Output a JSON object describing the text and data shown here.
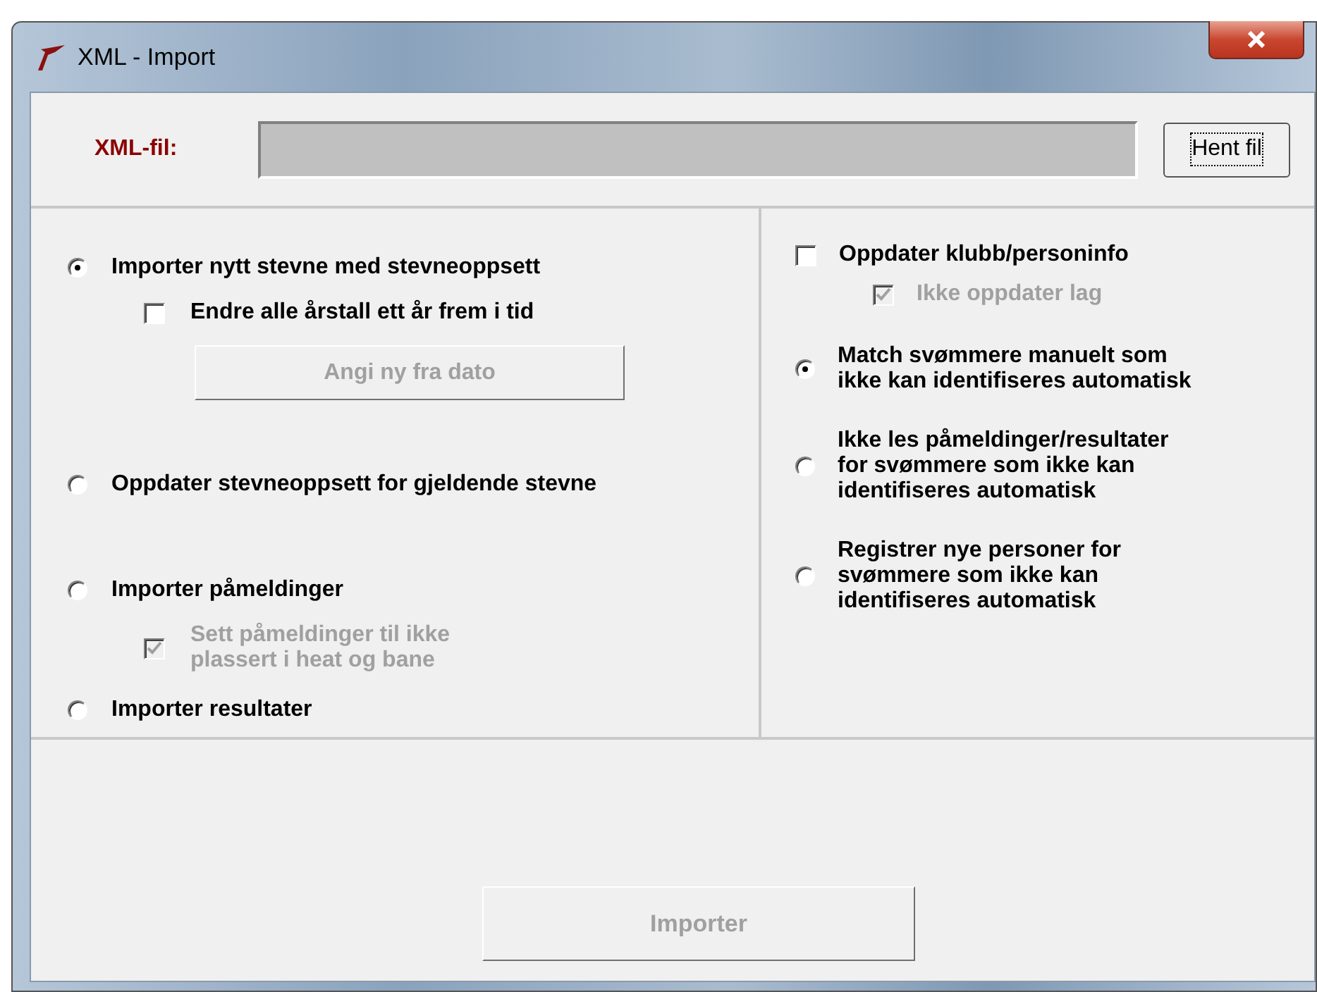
{
  "window": {
    "title": "XML - Import"
  },
  "file_row": {
    "label": "XML-fil:",
    "button": {
      "label": "Hent fil",
      "focused": true
    }
  },
  "left_options": [
    {
      "kind": "radio",
      "label": "Importer nytt stevne med stevneoppsett",
      "selected": true,
      "children": [
        {
          "kind": "checkbox",
          "label": "Endre alle årstall ett år frem i tid",
          "checked": false,
          "disabled": false
        },
        {
          "kind": "button",
          "label": "Angi ny fra dato",
          "disabled": true
        }
      ]
    },
    {
      "kind": "radio",
      "label": "Oppdater stevneoppsett for gjeldende stevne",
      "selected": false
    },
    {
      "kind": "radio",
      "label": "Importer påmeldinger",
      "selected": false,
      "children": [
        {
          "kind": "checkbox",
          "label": "Sett påmeldinger til ikke plassert i heat og bane",
          "checked": true,
          "disabled": true
        }
      ]
    },
    {
      "kind": "radio",
      "label": "Importer resultater",
      "selected": false
    }
  ],
  "right_options": [
    {
      "kind": "checkbox",
      "label": "Oppdater klubb/personinfo",
      "checked": false,
      "disabled": false,
      "children": [
        {
          "kind": "checkbox",
          "label": "Ikke oppdater lag",
          "checked": true,
          "disabled": true
        }
      ]
    },
    {
      "kind": "radio",
      "label": "Match svømmere manuelt som ikke kan identifiseres automatisk",
      "selected": true
    },
    {
      "kind": "radio",
      "label": "Ikke les påmeldinger/resultater for svømmere som ikke kan identifiseres automatisk",
      "selected": false
    },
    {
      "kind": "radio",
      "label": "Registrer nye personer for svømmere som ikke kan identifiseres automatisk",
      "selected": false
    }
  ],
  "import_button": {
    "label": "Importer",
    "disabled": true
  }
}
